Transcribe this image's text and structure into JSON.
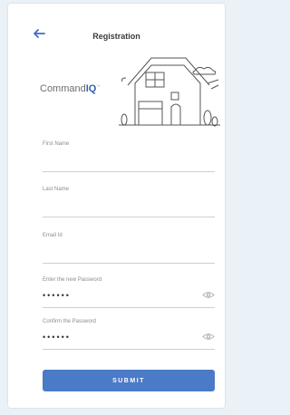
{
  "header": {
    "title": "Registration"
  },
  "brand": {
    "name_part1": "Command",
    "name_part2": "IQ",
    "tm": "™"
  },
  "form": {
    "first_name": {
      "label": "First Name",
      "value": ""
    },
    "last_name": {
      "label": "Last Name",
      "value": ""
    },
    "email": {
      "label": "Email Id",
      "value": ""
    },
    "new_password": {
      "label": "Enter the new Password",
      "value": "••••••"
    },
    "confirm_password": {
      "label": "Confirm the Password",
      "value": "••••••"
    }
  },
  "submit_label": "SUBMIT",
  "colors": {
    "accent": "#4b7ac7",
    "brand_blue": "#2f63b2"
  },
  "icons": [
    "back-arrow-icon",
    "house-illustration",
    "eye-icon"
  ]
}
